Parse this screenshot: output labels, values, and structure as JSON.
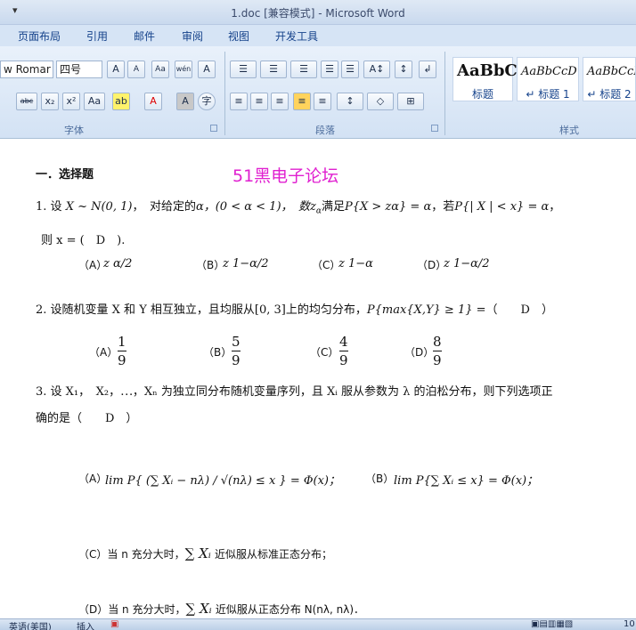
{
  "window": {
    "title": "1.doc [兼容模式] - Microsoft Word",
    "qa_toolbar_arrow": "▾"
  },
  "tabs": [
    "页面布局",
    "引用",
    "邮件",
    "审阅",
    "视图",
    "开发工具"
  ],
  "ribbon": {
    "font_name": "w Romar",
    "font_size": "四号",
    "font_group_label": "字体",
    "paragraph_group_label": "段落",
    "styles_group_label": "样式",
    "font_buttons": [
      "A",
      "A",
      "Aa",
      "wén",
      "A",
      "abc",
      "x₂",
      "x²",
      "Aa",
      "ab",
      "A",
      "A",
      "字"
    ],
    "paragraph_buttons": [
      "☰",
      "☰",
      "☰",
      "☰",
      "☰",
      "A↕",
      "↲",
      "≡",
      "≡",
      "≡",
      "≡",
      "≡",
      "↕",
      "◇",
      "⊞"
    ],
    "styles": [
      {
        "sample": "AaBbC",
        "name": "标题"
      },
      {
        "sample": "AaBbCcD",
        "name": "↵ 标题 1"
      },
      {
        "sample": "AaBbCcD",
        "name": "↵ 标题 2"
      }
    ]
  },
  "document": {
    "section_title": "一．选择题",
    "watermark": "51黑电子论坛",
    "q1": {
      "prefix": "1. 设",
      "formula_a": "X ~ N(0, 1)",
      "mid": "，　对给定的",
      "alpha": "α",
      "range": "，(0 < α < 1)，　数",
      "z_alpha": "z",
      "z_sub": "α",
      "cond": "满足",
      "p1": "P{X > zα} = α",
      "if": "，若",
      "p2": "P{| X | < x} = α",
      "end": "，",
      "answer_line": "则 x = (　D　)."
    },
    "q1_options": [
      "（A）",
      "（B）",
      "（C）",
      "（D）"
    ],
    "q1_option_values": [
      "z α/2",
      "z 1−α/2",
      "z 1−α",
      "z 1−α/2"
    ],
    "q2": {
      "text": "2. 设随机变量 X 和 Y 相互独立，且均服从[0, 3]上的均匀分布，",
      "formula": "P{max{X,Y} ≥ 1} =",
      "answer": "（　　D　）"
    },
    "q2_options": [
      {
        "label": "（A）",
        "num": "1",
        "den": "9"
      },
      {
        "label": "（B）",
        "num": "5",
        "den": "9"
      },
      {
        "label": "（C）",
        "num": "4",
        "den": "9"
      },
      {
        "label": "（D）",
        "num": "8",
        "den": "9"
      }
    ],
    "q3": {
      "line1": "3. 设 X₁，　X₂，⋯，Xₙ 为独立同分布随机变量序列，且 Xᵢ 服从参数为 λ 的泊松分布，则下列选项正",
      "line2": "确的是（　　D　）"
    },
    "q3_option_a_label": "（A）",
    "q3_option_a_formula": "lim P{ (∑ Xᵢ − nλ) / √(nλ) ≤ x } = Φ(x)；",
    "q3_option_b_label": "（B）",
    "q3_option_b_formula": "lim P{∑ Xᵢ ≤ x} = Φ(x)；",
    "q3_option_c": "（C）当 n 充分大时，",
    "q3_option_c_formula": "∑ Xᵢ",
    "q3_option_c_end": "近似服从标准正态分布；",
    "q3_option_d": "（D）当 n 充分大时，",
    "q3_option_d_formula": "∑ Xᵢ",
    "q3_option_d_end": "近似服从正态分布 N(nλ, nλ)．"
  },
  "statusbar": {
    "language": "英语(美国)",
    "insert": "插入",
    "zoom": "10"
  }
}
